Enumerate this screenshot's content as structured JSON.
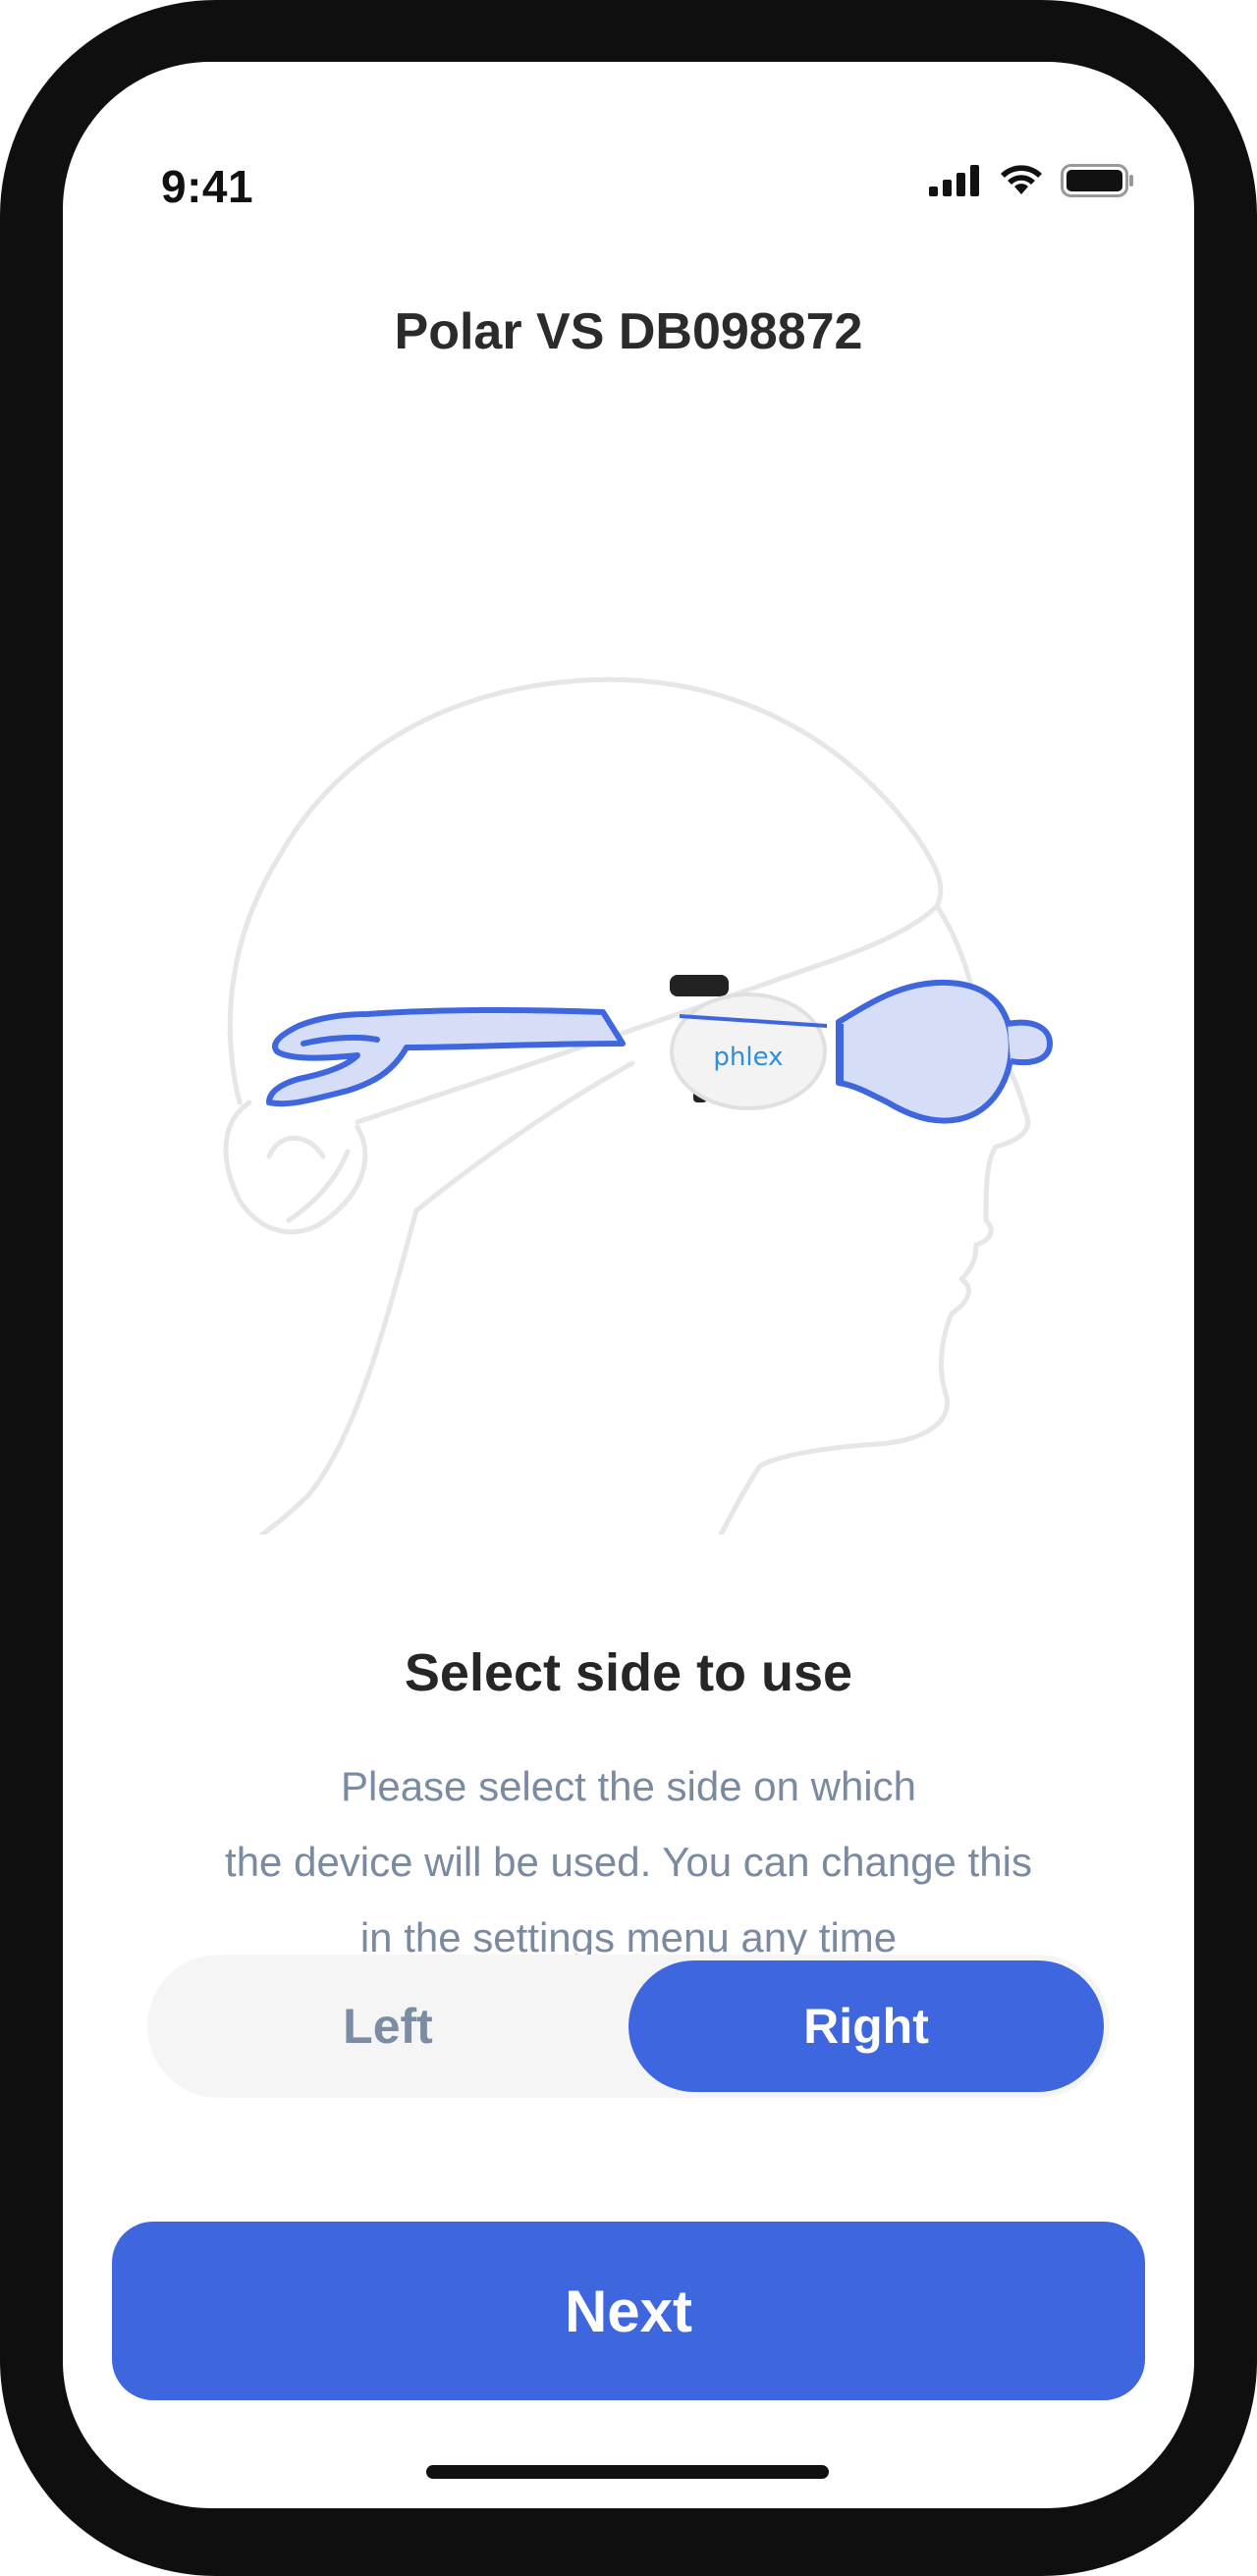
{
  "status_bar": {
    "time": "9:41"
  },
  "header": {
    "title": "Polar VS DB098872"
  },
  "illustration": {
    "device_brand": "phlex"
  },
  "content": {
    "heading": "Select side to use",
    "description_lines": [
      "Please select the side on which",
      "the device will be used. You can change this",
      "in the settings menu any time"
    ]
  },
  "side_selector": {
    "options": [
      "Left",
      "Right"
    ],
    "selected": "Right"
  },
  "footer": {
    "next_label": "Next"
  },
  "colors": {
    "accent": "#3e66de",
    "goggle_fill": "#d6def7",
    "muted_text": "#7a8aa0",
    "sketch_line": "#e6e6e6"
  }
}
